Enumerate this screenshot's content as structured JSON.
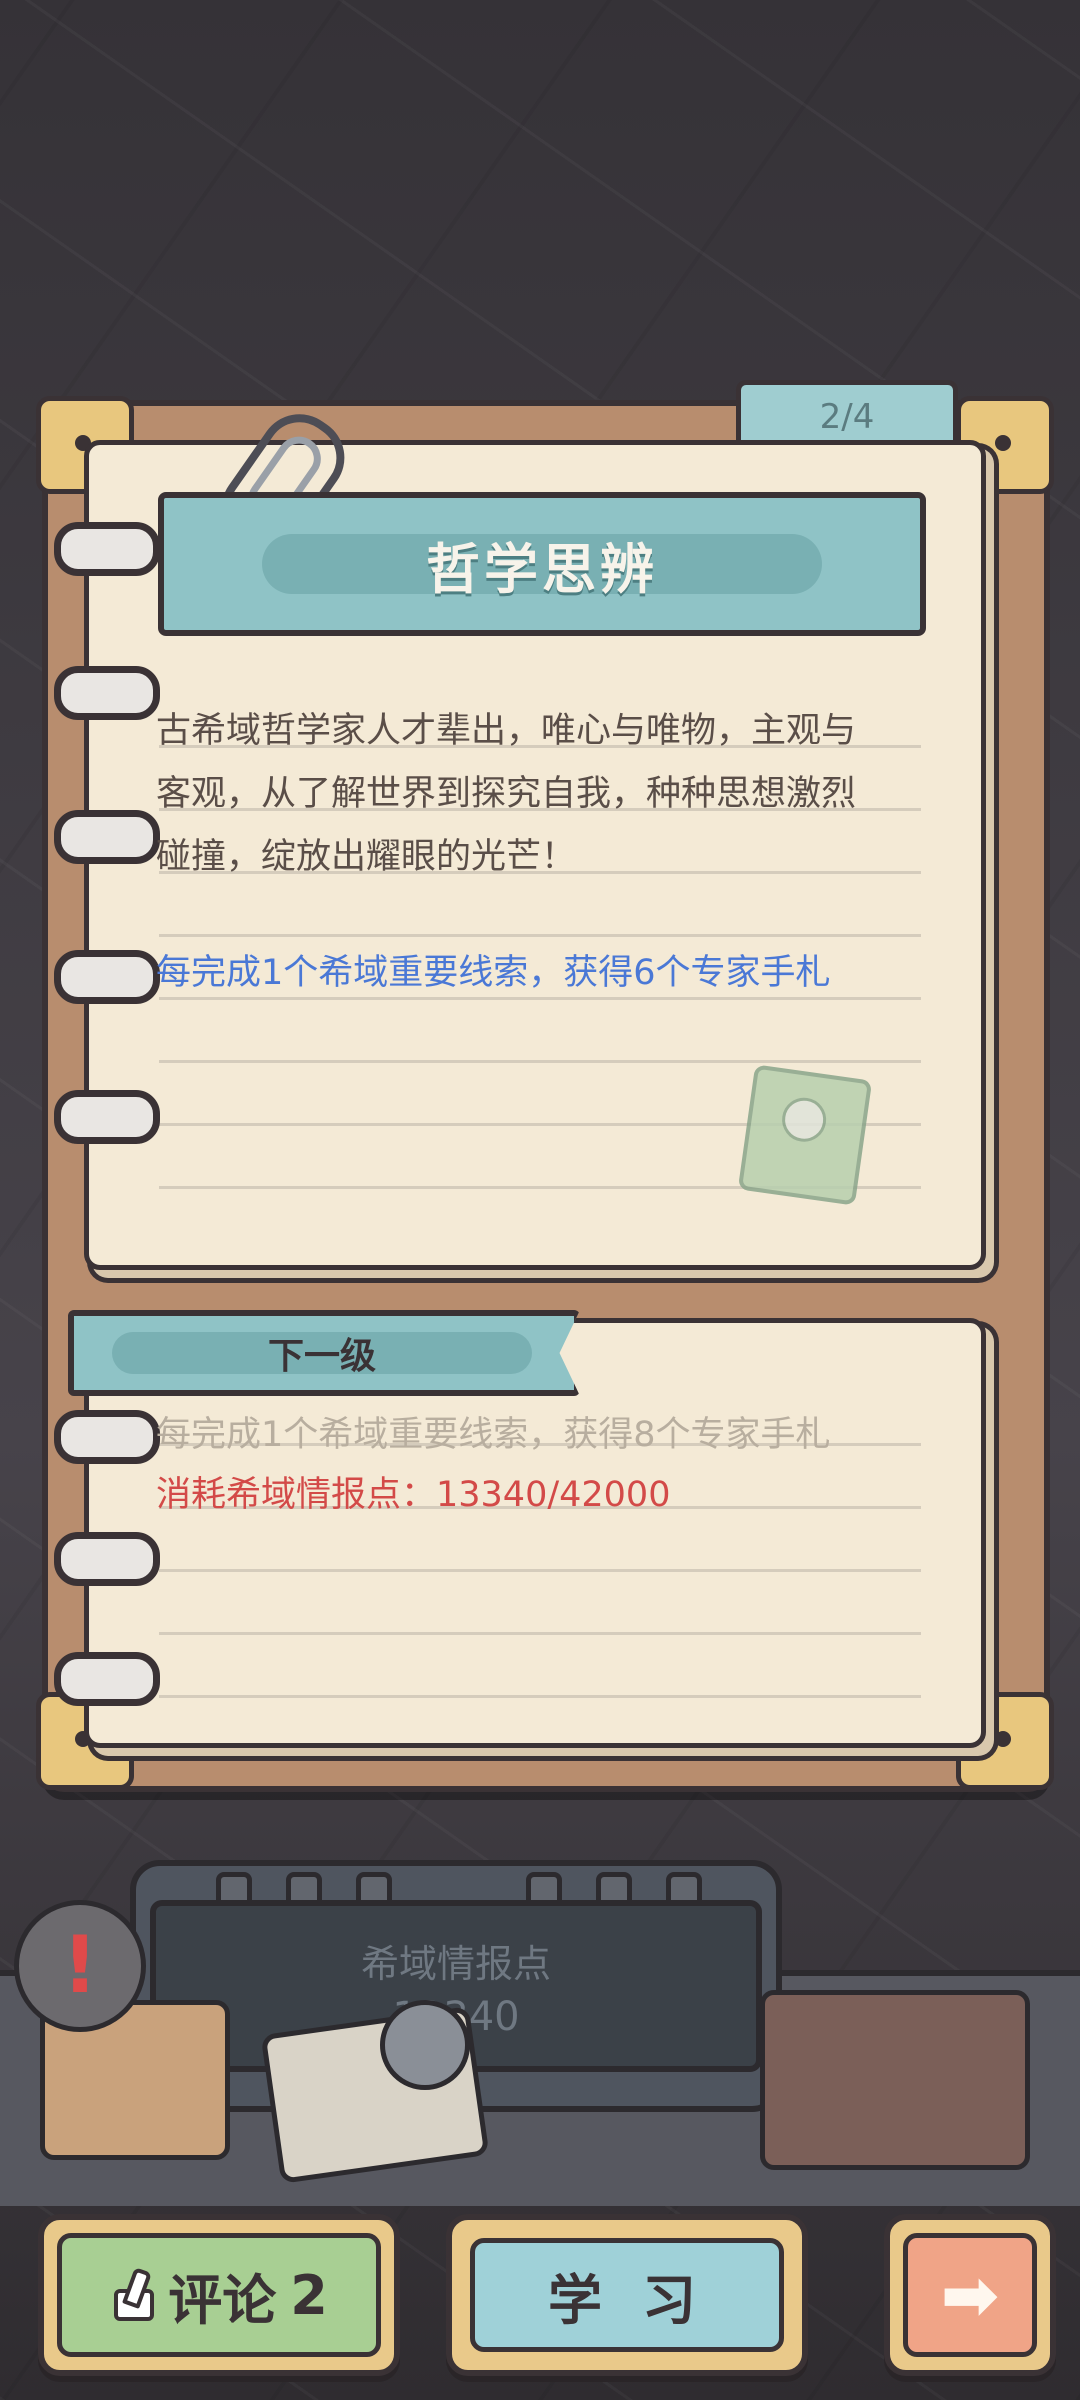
{
  "page_indicator": "2/4",
  "card": {
    "title": "哲学思辨",
    "description_lines": [
      "古希域哲学家人才辈出，唯心与唯物，主观与",
      "客观，从了解世界到探究自我，种种思想激烈",
      "碰撞，绽放出耀眼的光芒！"
    ],
    "bonus": "每完成1个希域重要线索，获得6个专家手札"
  },
  "next_level": {
    "label": "下一级",
    "bonus": "每完成1个希域重要线索，获得8个专家手札",
    "cost": "消耗希域情报点：13340/42000"
  },
  "intel": {
    "label": "希域情报点",
    "value": "13340"
  },
  "buttons": {
    "comment_label": "评论",
    "comment_count": "2",
    "study_label": "学习",
    "next_arrow": "➡"
  },
  "alert_glyph": "!",
  "colors": {
    "bonus_text": "#4a78d6",
    "cost_text": "#d34a48",
    "banner": "#8fc3c6"
  }
}
